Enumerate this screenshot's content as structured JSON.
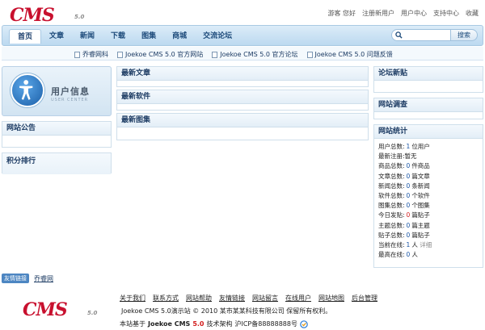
{
  "logo": {
    "brand": "CMS",
    "version": "5.0"
  },
  "top_links": [
    "游客 您好",
    "注册新用户",
    "用户中心",
    "支持中心",
    "收藏"
  ],
  "nav": {
    "items": [
      "首页",
      "文章",
      "新闻",
      "下载",
      "图集",
      "商城",
      "交流论坛"
    ],
    "active_index": 0
  },
  "search": {
    "value": "",
    "button_label": "搜索"
  },
  "quick_links": [
    "乔睿网科",
    "Joekoe CMS 5.0 官方网站",
    "Joekoe CMS 5.0 官方论坛",
    "Joekoe CMS 5.0 问题反馈"
  ],
  "user_center": {
    "title": "用户信息",
    "subtitle": "USER CENTER"
  },
  "left_panels": {
    "notice": "网站公告",
    "ranking": "积分排行"
  },
  "middle_panels": {
    "articles": "最新文章",
    "software": "最新软件",
    "gallery": "最新图集"
  },
  "right_panels": {
    "forum": "论坛新贴",
    "survey": "网站调查",
    "stats": "网站统计"
  },
  "stats": {
    "users_label": "用户总数:",
    "users_value": "1",
    "users_unit": "位用户",
    "newest_label": "最新注册:",
    "newest_value": "暂无",
    "products_label": "商品总数:",
    "products_value": "0",
    "products_unit": "件商品",
    "articles_label": "文章总数:",
    "articles_value": "0",
    "articles_unit": "篇文章",
    "news_label": "新闻总数:",
    "news_value": "0",
    "news_unit": "条新闻",
    "software_label": "软件总数:",
    "software_value": "0",
    "software_unit": "个软件",
    "gallery_label": "图集总数:",
    "gallery_value": "0",
    "gallery_unit": "个图集",
    "today_label": "今日发贴:",
    "today_value": "0",
    "today_unit": "篇贴子",
    "topics_label": "主题总数:",
    "topics_value": "0",
    "topics_unit": "篇主题",
    "posts_label": "贴子总数:",
    "posts_value": "0",
    "posts_unit": "篇贴子",
    "online_label": "当前在线:",
    "online_value": "1",
    "online_unit": "人",
    "online_detail": "详细",
    "max_label": "最高在线:",
    "max_value": "0",
    "max_unit": "人"
  },
  "friend_links": {
    "tag": "友情链接",
    "link": "乔睿网"
  },
  "footer": {
    "links": [
      "关于我们",
      "联系方式",
      "网站帮助",
      "友情链接",
      "网站留言",
      "在线用户",
      "网站地图",
      "后台管理"
    ],
    "copyright": "Joekoe CMS 5.0演示站  © 2010 某市某某科技有限公司 保留所有权利。",
    "powered_prefix": "本站基于",
    "powered_brand": "Joekoe CMS",
    "powered_version": "5.0",
    "powered_suffix": "技术架构",
    "icp": "沪ICP备88888888号"
  },
  "colors": {
    "brand_red": "#c8102e",
    "nav_blue": "#1c4a7a",
    "number_blue": "#1a56a6",
    "alert_red": "#d21c1c"
  }
}
